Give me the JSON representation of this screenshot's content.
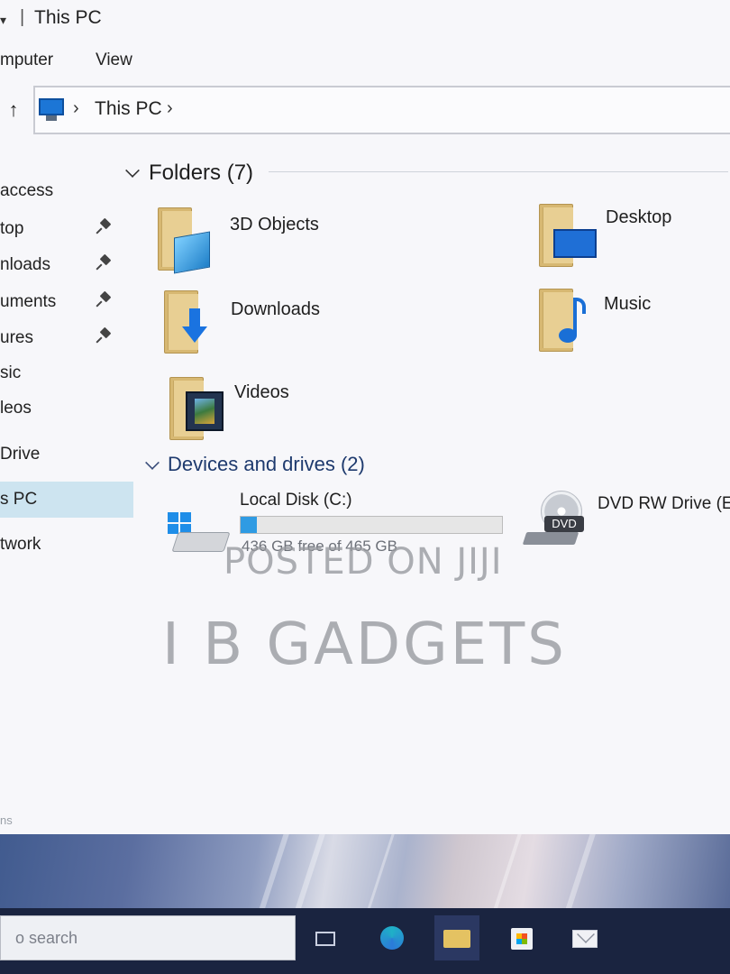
{
  "window": {
    "quick_access_arrow": "▾",
    "title_separator": "|",
    "title": "This PC"
  },
  "ribbon": {
    "tabs": [
      "mputer",
      "View"
    ]
  },
  "address": {
    "up_arrow": "↑",
    "chevron": "›",
    "crumb": "This PC"
  },
  "nav": {
    "items": [
      {
        "label": "access",
        "pinned": false
      },
      {
        "label": "top",
        "pinned": true
      },
      {
        "label": "nloads",
        "pinned": true
      },
      {
        "label": "uments",
        "pinned": true
      },
      {
        "label": "ures",
        "pinned": true
      },
      {
        "label": "sic",
        "pinned": false
      },
      {
        "label": "leos",
        "pinned": false
      },
      {
        "label": "Drive",
        "pinned": false
      },
      {
        "label": "s PC",
        "pinned": false,
        "selected": true
      },
      {
        "label": "twork",
        "pinned": false
      }
    ]
  },
  "folders": {
    "heading": "Folders (7)",
    "items": [
      {
        "name": "3D Objects",
        "icon": "3d-objects-icon"
      },
      {
        "name": "Desktop",
        "icon": "desktop-folder-icon"
      },
      {
        "name": "Downloads",
        "icon": "downloads-folder-icon"
      },
      {
        "name": "Music",
        "icon": "music-folder-icon"
      },
      {
        "name": "Videos",
        "icon": "videos-folder-icon"
      }
    ]
  },
  "devices": {
    "heading": "Devices and drives (2)",
    "local_disk": {
      "name": "Local Disk (C:)",
      "free_text": "436 GB free of 465 GB",
      "used_fraction": 0.062
    },
    "dvd": {
      "name": "DVD RW Drive (E:)",
      "badge": "DVD"
    }
  },
  "watermarks": {
    "line1": "POSTED ON JIJI",
    "line2": "I B GADGETS"
  },
  "footer": {
    "cut_text": "ns"
  },
  "taskbar": {
    "search_placeholder": "o search",
    "icons": [
      "task-view-icon",
      "edge-icon",
      "file-explorer-icon",
      "store-icon",
      "mail-icon"
    ]
  },
  "colors": {
    "accent": "#2f9be3",
    "group_heading": "#1e3a6e",
    "selected_nav": "#cde4f0",
    "taskbar": "#1a2440"
  }
}
